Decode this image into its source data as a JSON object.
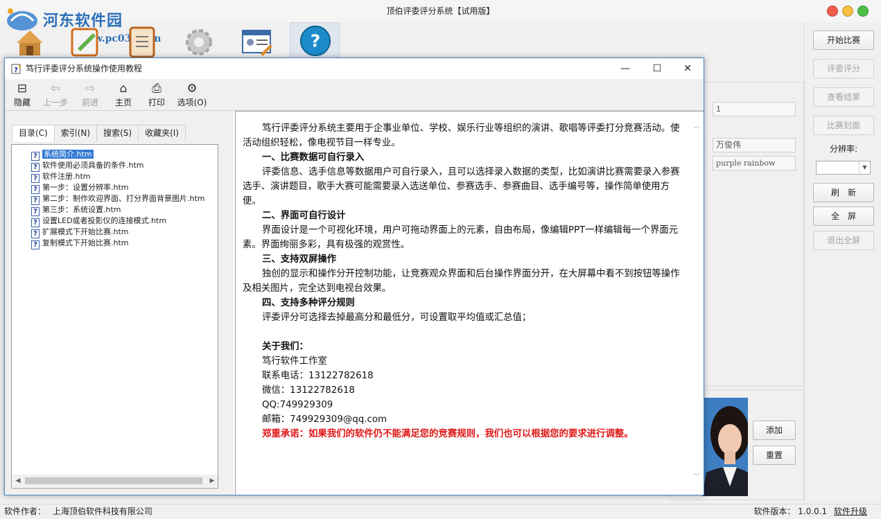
{
  "main_window": {
    "title": "顶伯评委评分系统【试用版】",
    "watermark": "河东软件园",
    "watermark_url": "www.pc0359.cn",
    "traffic_colors": [
      "#f25b4a",
      "#f7c043",
      "#4fbf49"
    ]
  },
  "right_panel": {
    "buttons": {
      "start": "开始比赛",
      "judge": "评委评分",
      "results": "查看结果",
      "cover": "比赛封面",
      "refresh": "刷　新",
      "fullscreen": "全　屏",
      "exit_fullscreen": "退出全屏"
    },
    "resolution_label": "分辨率:",
    "resolution_value": ""
  },
  "middle_panel": {
    "field_number": "1",
    "field_name": "万俊伟",
    "field_song": "purple rainbow",
    "add_button": "添加",
    "reset_button": "重置"
  },
  "statusbar": {
    "author_label": "软件作者：",
    "author_value": "上海顶伯软件科技有限公司",
    "version_label": "软件版本：",
    "version_value": "1.0.0.1",
    "upgrade_link": "软件升级"
  },
  "help_window": {
    "title": "笃行评委评分系统操作使用教程",
    "controls": {
      "minimize": "—",
      "maximize": "☐",
      "close": "✕"
    },
    "toolbar": {
      "hide": "隐藏",
      "back": "上一步",
      "forward": "前进",
      "home": "主页",
      "print": "打印",
      "options": "选项(O)"
    },
    "tabs": [
      "目录(C)",
      "索引(N)",
      "搜索(S)",
      "收藏夹(I)"
    ],
    "tree_items": [
      "系统简介.htm",
      "软件使用必须具备的条件.htm",
      "软件注册.htm",
      "第一步：设置分辨率.htm",
      "第二步：制作欢迎界面、打分界面背景图片.htm",
      "第三步：系统设置.htm",
      "设置LED或者投影仪的连接模式.htm",
      "扩展模式下开始比赛.htm",
      "复制模式下开始比赛.htm"
    ],
    "selected_index": 0,
    "content": {
      "intro": "笃行评委评分系统主要用于企事业单位、学校、娱乐行业等组织的演讲、歌唱等评委打分竞赛活动。使活动组织轻松，像电视节目一样专业。",
      "h1": "一、比赛数据可自行录入",
      "p1": "评委信息、选手信息等数据用户可自行录入，且可以选择录入数据的类型，比如演讲比赛需要录入参赛选手、演讲题目，歌手大赛可能需要录入选送单位、参赛选手、参赛曲目、选手编号等，操作简单使用方便。",
      "h2": "二、界面可自行设计",
      "p2": "界面设计是一个可视化环境，用户可拖动界面上的元素，自由布局，像编辑PPT一样编辑每一个界面元素。界面绚丽多彩，具有极强的观赏性。",
      "h3": "三、支持双屏操作",
      "p3": "独创的显示和操作分开控制功能，让竞赛观众界面和后台操作界面分开，在大屏幕中看不到按钮等操作及相关图片，完全达到电视台效果。",
      "h4": "四、支持多种评分规则",
      "p4": "评委评分可选择去掉最高分和最低分，可设置取平均值或汇总值；",
      "about_title": "关于我们：",
      "studio": "笃行软件工作室",
      "phone": "联系电话：13122782618",
      "wechat": "微信：13122782618",
      "qq": "QQ:749929309",
      "email": "邮箱：749929309@qq.com",
      "promise": "郑重承诺：如果我们的软件仍不能满足您的竞赛规则，我们也可以根据您的要求进行调整。"
    }
  }
}
